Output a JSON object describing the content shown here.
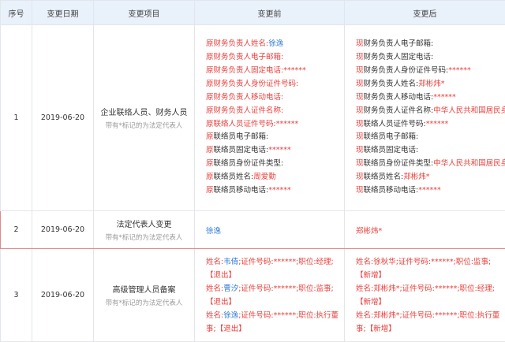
{
  "headers": {
    "index": "序号",
    "date": "变更日期",
    "item": "变更项目",
    "before": "变更前",
    "after": "变更后"
  },
  "rows": [
    {
      "index": "1",
      "date": "2019-06-20",
      "item": "企业联络人员、财务人员",
      "note": "带有*标记的为法定代表人",
      "before": [
        {
          "label": "原财务负责人姓名:",
          "value": "徐逸"
        },
        {
          "label": "原财务负责人电子邮箱:",
          "value": ""
        },
        {
          "label": "原财务负责人固定电话:",
          "value": "******"
        },
        {
          "label": "原财务负责人身份证件号码:",
          "value": ""
        },
        {
          "label": "原财务负责人移动电话:",
          "value": ""
        },
        {
          "label": "原财务负责人证件名称:",
          "value": ""
        },
        {
          "label": "原联络人员证件号码:",
          "value": "******"
        },
        {
          "label": "原联络员电子邮箱:",
          "value": ""
        },
        {
          "label": "原联络员固定电话:",
          "value": "******"
        },
        {
          "label": "原联络员身份证件类型:",
          "value": ""
        },
        {
          "label": "原联络员姓名:",
          "value": "周爱勤"
        },
        {
          "label": "原联络员移动电话:",
          "value": "******"
        }
      ],
      "after": [
        {
          "label": "现财务负责人电子邮箱:",
          "value": ""
        },
        {
          "label": "现财务负责人固定电话:",
          "value": ""
        },
        {
          "label": "现财务负责人身份证件号码:",
          "value": "******"
        },
        {
          "label": "现财务负责人姓名:",
          "value": "郑彬炜*"
        },
        {
          "label": "现财务负责人移动电话:",
          "value": "******"
        },
        {
          "label": "现财务负责人证件名称:",
          "value": "中华人民共和国居民身份证"
        },
        {
          "label": "现联络人员证件号码:",
          "value": "******"
        },
        {
          "label": "现联络员电子邮箱:",
          "value": ""
        },
        {
          "label": "现联络员固定电话:",
          "value": ""
        },
        {
          "label": "现联络员身份证件类型:",
          "value": "中华人民共和国居民身份证"
        },
        {
          "label": "现联络员姓名:",
          "value": "郑彬炜*"
        },
        {
          "label": "现联络员移动电话:",
          "value": "******"
        }
      ]
    },
    {
      "index": "2",
      "date": "2019-06-20",
      "item": "法定代表人变更",
      "note": "带有*标记的为法定代表人",
      "before_value": "徐逸",
      "after_value": "郑彬炜*"
    },
    {
      "index": "3",
      "date": "2019-06-20",
      "item": "高级管理人员备案",
      "note": "带有*标记的为法定代表人",
      "before": [
        {
          "name": "韦倩",
          "text": "姓名:韦倩;证件号码:******;职位:经理;",
          "tag": "【退出】"
        },
        {
          "name": "曹汐",
          "text": "姓名:曹汐;证件号码:******;职位:监事;",
          "tag": "【退出】"
        },
        {
          "name": "徐逸",
          "text": "姓名:徐逸;证件号码:******;职位:执行董事;",
          "tag": "【退出】"
        }
      ],
      "after": [
        {
          "text": "姓名:徐秋华;证件号码:******;职位:监事;",
          "tag": "【新增】"
        },
        {
          "text": "姓名:郑彬炜*;证件号码:******;职位:经理;",
          "tag": "【新增】"
        },
        {
          "text": "姓名:郑彬炜*;证件号码:******;职位:执行董事;",
          "tag": "【新增】"
        }
      ]
    }
  ],
  "colors": {
    "header_bg": "#e9f1fb",
    "border": "#e2e6ec",
    "red": "#e8403c",
    "blue": "#2f7bd6",
    "highlight_border": "#e38a8a"
  }
}
